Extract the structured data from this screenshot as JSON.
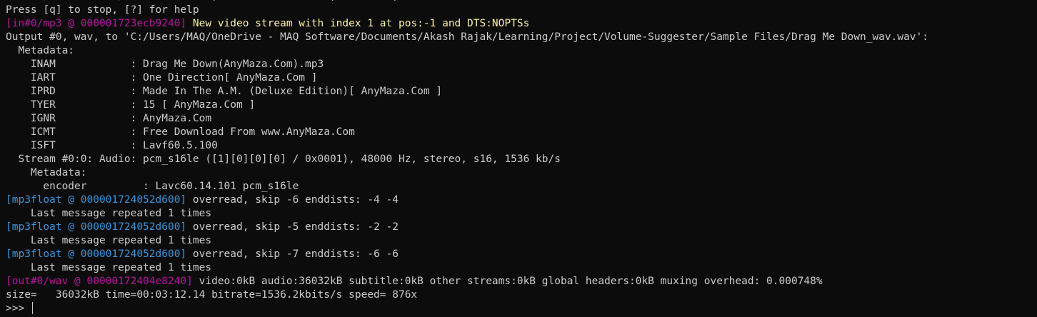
{
  "colors": {
    "background": "#0c0c0c",
    "text": "#cccccc",
    "tag_purple": "#b5179e",
    "tag_blue": "#3a96dd",
    "warning_yellow": "#f9f1a5"
  },
  "partial_top_line": "      /           /              ,                  ,         ,",
  "lines": {
    "help": "Press [q] to stop, [?] for help",
    "in_tag": "[in#0/mp3 @ 000001723ecb9240]",
    "in_msg": " New video stream with index 1 at pos:-1 and DTS:NOPTSs",
    "output": "Output #0, wav, to 'C:/Users/MAQ/OneDrive - MAQ Software/Documents/Akash Rajak/Learning/Project/Volume-Suggester/Sample Files/Drag Me Down_wav.wav':",
    "metadata_header": "  Metadata:",
    "inam": "    INAM            : Drag Me Down(AnyMaza.Com).mp3",
    "iart": "    IART            : One Direction[ AnyMaza.Com ]",
    "iprd": "    IPRD            : Made In The A.M. (Deluxe Edition)[ AnyMaza.Com ]",
    "tyer": "    TYER            : 15 [ AnyMaza.Com ]",
    "ignr": "    IGNR            : AnyMaza.Com",
    "icmt": "    ICMT            : Free Download From www.AnyMaza.Com",
    "isft": "    ISFT            : Lavf60.5.100",
    "stream": "  Stream #0:0: Audio: pcm_s16le ([1][0][0][0] / 0x0001), 48000 Hz, stereo, s16, 1536 kb/s",
    "stream_metadata": "    Metadata:",
    "encoder": "      encoder         : Lavc60.14.101 pcm_s16le",
    "mp3float_tag": "[mp3float @ 000001724052d600]",
    "overread_1": " overread, skip -6 enddists: -4 -4",
    "repeated_1": "    Last message repeated 1 times",
    "overread_2": " overread, skip -5 enddists: -2 -2",
    "repeated_2": "    Last message repeated 1 times",
    "overread_3": " overread, skip -7 enddists: -6 -6",
    "repeated_3": "    Last message repeated 1 times",
    "out_tag": "[out#0/wav @ 00000172404e8240]",
    "out_msg": " video:0kB audio:36032kB subtitle:0kB other streams:0kB global headers:0kB muxing overhead: 0.000748%",
    "size": "size=   36032kB time=00:03:12.14 bitrate=1536.2kbits/s speed= 876x",
    "prompt": ">>> "
  }
}
